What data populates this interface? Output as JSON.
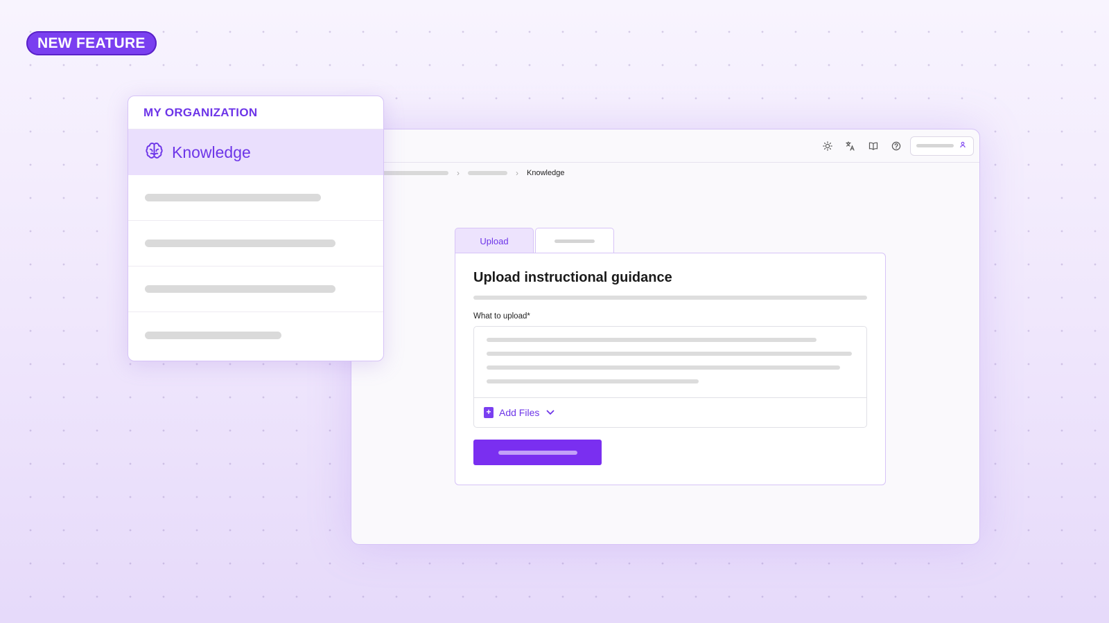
{
  "badge": {
    "label": "NEW FEATURE"
  },
  "panel": {
    "heading": "MY ORGANIZATION",
    "active_item": {
      "label": "Knowledge",
      "icon": "brain-icon"
    },
    "placeholder_items": 4
  },
  "window": {
    "topbar_icons": [
      "sun-icon",
      "translate-icon",
      "book-icon",
      "help-icon",
      "user-icon"
    ],
    "breadcrumb": {
      "current": "Knowledge"
    },
    "tabs": [
      {
        "label": "Upload",
        "active": true
      }
    ],
    "card": {
      "title": "Upload instructional guidance",
      "field_label": "What to upload*",
      "add_files_label": "Add Files"
    }
  },
  "colors": {
    "accent": "#7a3ff0",
    "accent_light": "#eadffd",
    "border": "#d6c3f7"
  }
}
